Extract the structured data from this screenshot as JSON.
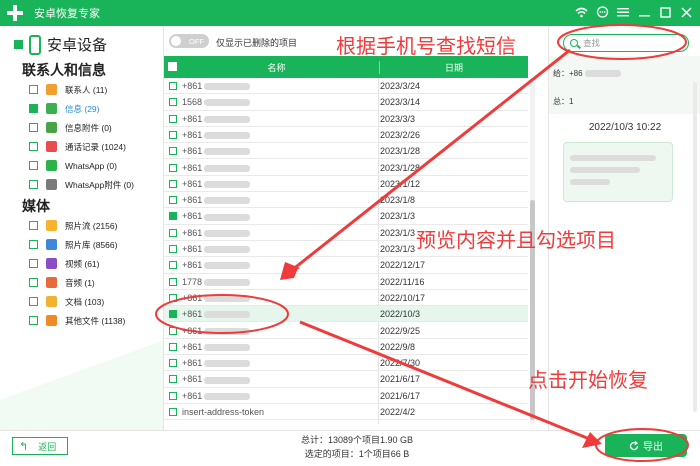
{
  "app": {
    "title": "安卓恢复专家"
  },
  "window_controls": [
    "wifi-icon",
    "chat-icon",
    "menu-icon",
    "minimize-icon",
    "maximize-icon",
    "close-icon"
  ],
  "sidebar": {
    "device": "安卓设备",
    "contacts_group": "联系人和信息",
    "media_group": "媒体",
    "contacts_items": [
      {
        "label": "联系人 (11)",
        "color": "#f0a030"
      },
      {
        "label": "信息 (29)",
        "color": "#3cb04c",
        "selected": true
      },
      {
        "label": "信息附件 (0)",
        "color": "#4aa348"
      },
      {
        "label": "通话记录 (1024)",
        "color": "#e84c4c"
      },
      {
        "label": "WhatsApp (0)",
        "color": "#29b34a"
      },
      {
        "label": "WhatsApp附件 (0)",
        "color": "#7a7a7a"
      }
    ],
    "media_items": [
      {
        "label": "照片流 (2156)",
        "color": "#f7b32b"
      },
      {
        "label": "照片库 (8566)",
        "color": "#3f87d8"
      },
      {
        "label": "视频 (61)",
        "color": "#8b4dc4"
      },
      {
        "label": "音频 (1)",
        "color": "#e86a3a"
      },
      {
        "label": "文档 (103)",
        "color": "#f2b130"
      },
      {
        "label": "其他文件 (1138)",
        "color": "#f08a24"
      }
    ]
  },
  "toolbar": {
    "toggle": "OFF",
    "filter_label": "仅显示已删除的项目"
  },
  "table": {
    "headers": {
      "name": "名称",
      "date": "日期"
    },
    "rows": [
      {
        "name": "+861",
        "date": "2023/3/24",
        "checked": false
      },
      {
        "name": "1568",
        "date": "2023/3/14",
        "checked": false
      },
      {
        "name": "+861",
        "date": "2023/3/3",
        "checked": false
      },
      {
        "name": "+861",
        "date": "2023/2/26",
        "checked": false
      },
      {
        "name": "+861",
        "date": "2023/1/28",
        "checked": false
      },
      {
        "name": "+861",
        "date": "2023/1/28",
        "checked": false
      },
      {
        "name": "+861",
        "date": "2023/1/12",
        "checked": false
      },
      {
        "name": "+861",
        "date": "2023/1/8",
        "checked": false
      },
      {
        "name": "+861",
        "date": "2023/1/3",
        "checked": true
      },
      {
        "name": "+861",
        "date": "2023/1/3",
        "checked": false
      },
      {
        "name": "+861",
        "date": "2023/1/3",
        "checked": false
      },
      {
        "name": "+861",
        "date": "2022/12/17",
        "checked": false
      },
      {
        "name": "1778",
        "date": "2022/11/16",
        "checked": false
      },
      {
        "name": "+861",
        "date": "2022/10/17",
        "checked": false
      },
      {
        "name": "+861",
        "date": "2022/10/3",
        "checked": true,
        "highlight": true
      },
      {
        "name": "+861",
        "date": "2022/9/25",
        "checked": false
      },
      {
        "name": "+861",
        "date": "2022/9/8",
        "checked": false
      },
      {
        "name": "+861",
        "date": "2022/7/30",
        "checked": false
      },
      {
        "name": "+861",
        "date": "2021/6/17",
        "checked": false
      },
      {
        "name": "+861",
        "date": "2021/6/17",
        "checked": false
      },
      {
        "name": "insert-address-token",
        "date": "2022/4/2",
        "checked": false
      }
    ]
  },
  "preview": {
    "search_placeholder": "查找",
    "to_label": "给：+86",
    "total_label": "总：1",
    "time": "2022/10/3 10:22"
  },
  "footer": {
    "back": "返回",
    "total": "总计：13089个项目1.90 GB",
    "selected": "选定的项目：1个项目66 B",
    "export": "导出"
  },
  "annotations": {
    "search_hint": "根据手机号查找短信",
    "select_hint": "预览内容并且勾选项目",
    "export_hint": "点击开始恢复",
    "color": "#ef3b3b"
  }
}
